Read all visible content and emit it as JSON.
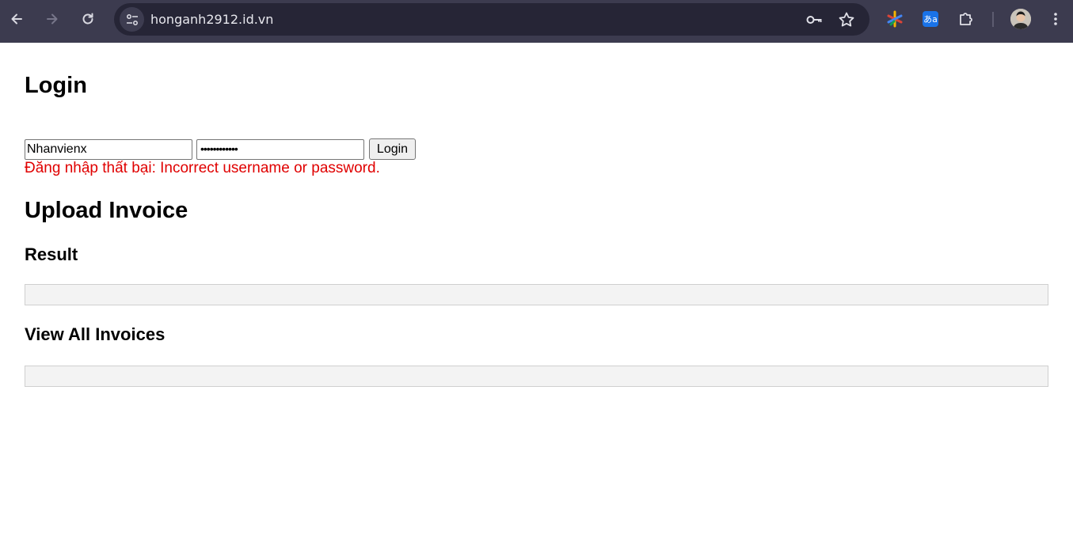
{
  "browser": {
    "url": "honganh2912.id.vn",
    "icons": {
      "back": "arrow-left-icon",
      "forward": "arrow-right-icon",
      "reload": "reload-icon",
      "site_info": "tune-icon",
      "password": "key-icon",
      "bookmark": "star-icon",
      "extension1": "sparkle-icon",
      "translate": "translate-icon",
      "extensions": "puzzle-icon",
      "menu": "kebab-menu-icon"
    },
    "translate_label": "あa"
  },
  "page": {
    "login_heading": "Login",
    "username_value": "Nhanvienx",
    "password_value": "••••••••••••",
    "login_button": "Login",
    "error_message": "Đăng nhập thất bại: Incorrect username or password.",
    "upload_heading": "Upload Invoice",
    "result_heading": "Result",
    "result_content": "",
    "view_heading": "View All Invoices",
    "view_content": ""
  },
  "colors": {
    "chrome_bg": "#3c3b4f",
    "omnibox_bg": "#262536",
    "error": "#e00000",
    "box_bg": "#f3f3f3"
  }
}
